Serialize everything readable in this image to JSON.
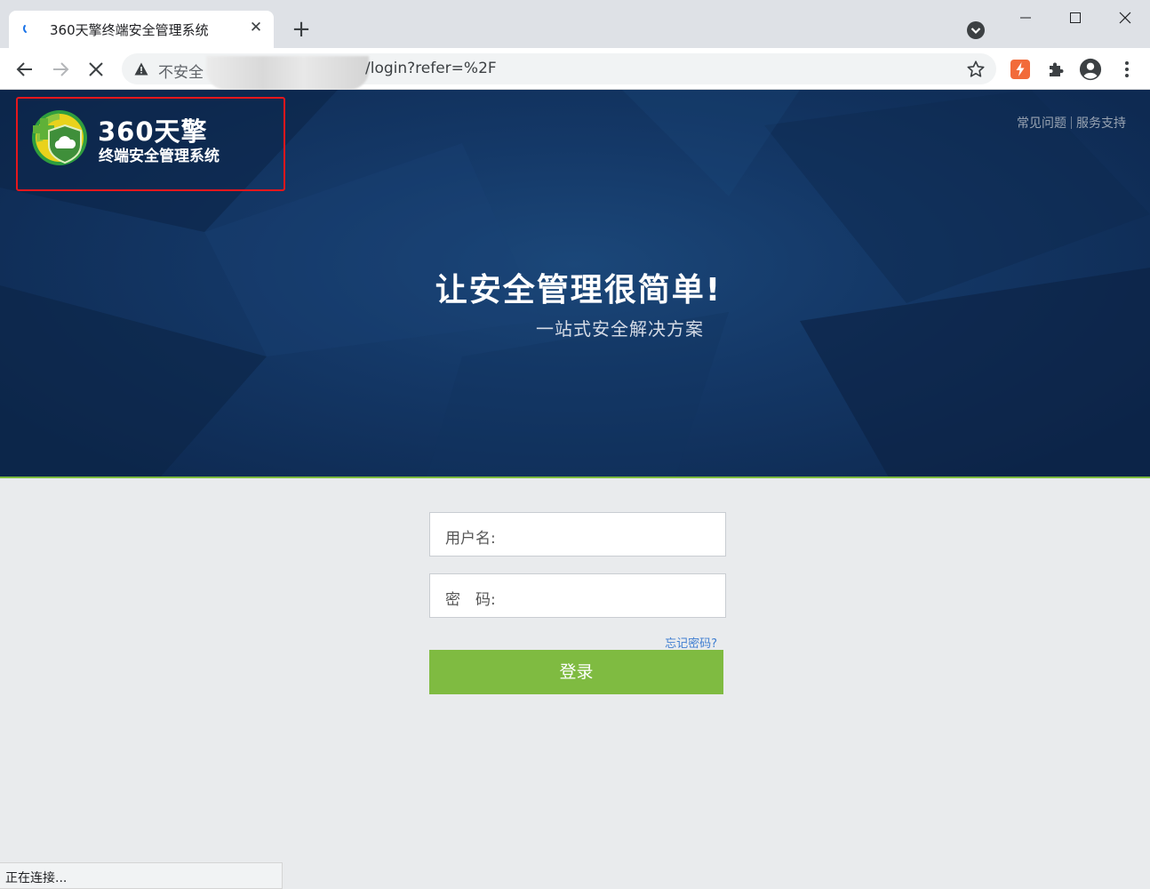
{
  "browser": {
    "tab_title": "360天擎终端安全管理系统",
    "tab_close": "✕",
    "new_tab": "+",
    "security_label": "不安全",
    "url_path": "/login?refer=%2F"
  },
  "page": {
    "brand_name": "360天擎",
    "brand_subtitle": "终端安全管理系统",
    "top_links": [
      "常见问题",
      "服务支持"
    ],
    "hero_title": "让安全管理很简单!",
    "hero_subtitle": "一站式安全解决方案",
    "login": {
      "username_label": "用户名:",
      "password_label": "密　码:",
      "username_value": "",
      "password_value": "",
      "forgot_password": "忘记密码?",
      "submit_label": "登录"
    }
  },
  "status_bar": "正在连接...",
  "colors": {
    "hero_background": "#143867",
    "accent_green": "#7fbb41",
    "link_blue": "#3f7ed1",
    "highlight_red": "#e6171c"
  }
}
